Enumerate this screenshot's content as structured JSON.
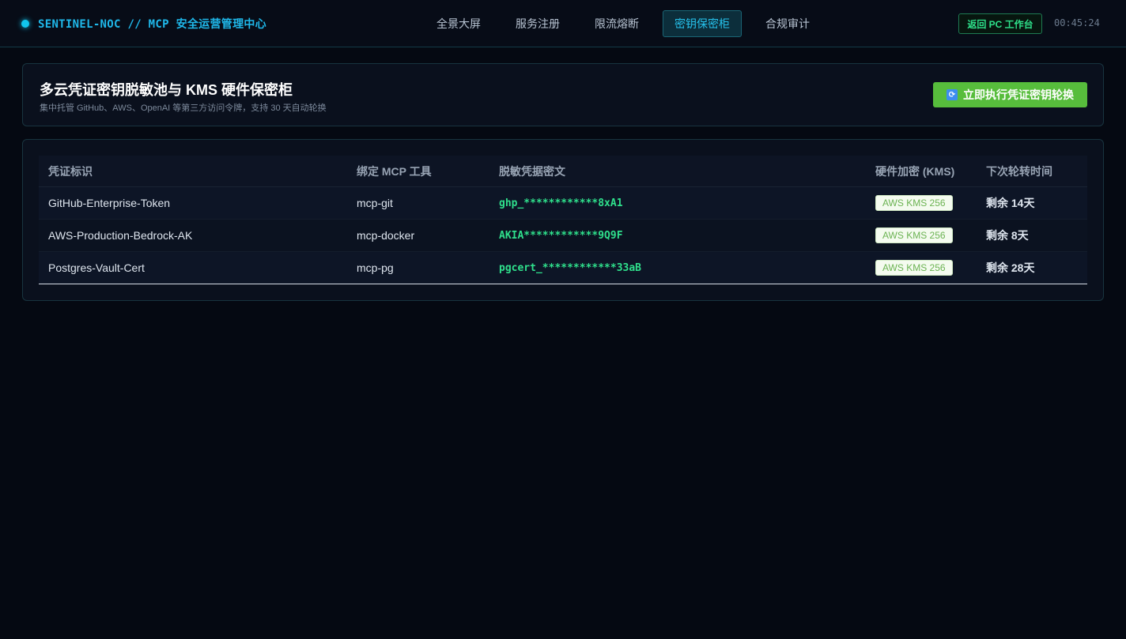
{
  "brand": {
    "title": "SENTINEL-NOC // MCP 安全运营管理中心"
  },
  "nav": {
    "items": [
      {
        "label": "全景大屏",
        "active": false
      },
      {
        "label": "服务注册",
        "active": false
      },
      {
        "label": "限流熔断",
        "active": false
      },
      {
        "label": "密钥保密柜",
        "active": true
      },
      {
        "label": "合规审计",
        "active": false
      }
    ],
    "return_label": "返回 PC 工作台",
    "clock": "00:45:24"
  },
  "header": {
    "title": "多云凭证密钥脱敏池与 KMS 硬件保密柜",
    "subtitle": "集中托管 GitHub、AWS、OpenAI 等第三方访问令牌，支持 30 天自动轮换",
    "rotate_icon": "🔄",
    "rotate_label": "立即执行凭证密钥轮换"
  },
  "table": {
    "columns": [
      "凭证标识",
      "绑定 MCP 工具",
      "脱敏凭据密文",
      "硬件加密 (KMS)",
      "下次轮转时间"
    ],
    "rows": [
      {
        "id": "GitHub-Enterprise-Token",
        "tool": "mcp-git",
        "secret": "ghp_************8xA1",
        "kms": "AWS KMS 256",
        "next": "剩余 14天"
      },
      {
        "id": "AWS-Production-Bedrock-AK",
        "tool": "mcp-docker",
        "secret": "AKIA************9Q9F",
        "kms": "AWS KMS 256",
        "next": "剩余 8天"
      },
      {
        "id": "Postgres-Vault-Cert",
        "tool": "mcp-pg",
        "secret": "pgcert_************33aB",
        "kms": "AWS KMS 256",
        "next": "剩余 28天"
      }
    ]
  },
  "colors": {
    "accent": "#1fb8ea",
    "success": "#57bd3c",
    "secret_text": "#2fe08c"
  }
}
